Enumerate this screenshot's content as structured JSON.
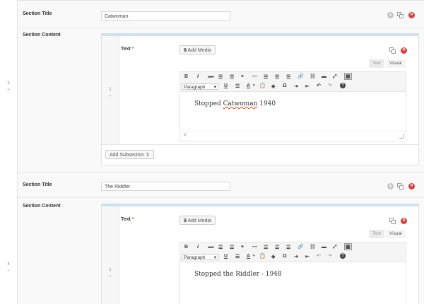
{
  "rows": [
    {
      "index": "3",
      "handle": "÷",
      "section_title_label": "Section Title",
      "section_title_value": "Catwoman",
      "section_content_label": "Section Content",
      "subrow_index": "1",
      "subrow_handle": "÷",
      "text_label": "Text",
      "required": "*",
      "add_media": "Add Media",
      "tabs": {
        "text": "Text",
        "visual": "Visual"
      },
      "format_select": "Paragraph",
      "editor_content_before": "Stopped ",
      "editor_content_underlined": "Catwoman",
      "editor_content_after": " 1940",
      "statusbar_path": "P",
      "add_subsection": "Add Subsection ⇕"
    },
    {
      "index": "4",
      "handle": "÷",
      "section_title_label": "Section Title",
      "section_title_value": "The Riddler",
      "section_content_label": "Section Content",
      "subrow_index": "1",
      "subrow_handle": "÷",
      "text_label": "Text",
      "required": "*",
      "add_media": "Add Media",
      "tabs": {
        "text": "Text",
        "visual": "Visual"
      },
      "format_select": "Paragraph",
      "editor_content": "Stopped the Riddler - 1948"
    }
  ],
  "toolbar": {
    "row1": [
      "B",
      "I",
      "ABC",
      "☰",
      "☰",
      "❝",
      "—",
      "☰",
      "☰",
      "☰",
      "🔗",
      "⛓",
      "▬",
      "⤢",
      "▦"
    ],
    "row2": [
      "U",
      "☰",
      "A",
      "▾",
      "📋",
      "◈",
      "Ω",
      "⇥",
      "⇤",
      "↶",
      "↷",
      "?"
    ]
  },
  "colors": {
    "accent": "#dd3d36",
    "bar": "#cfe1ea"
  }
}
